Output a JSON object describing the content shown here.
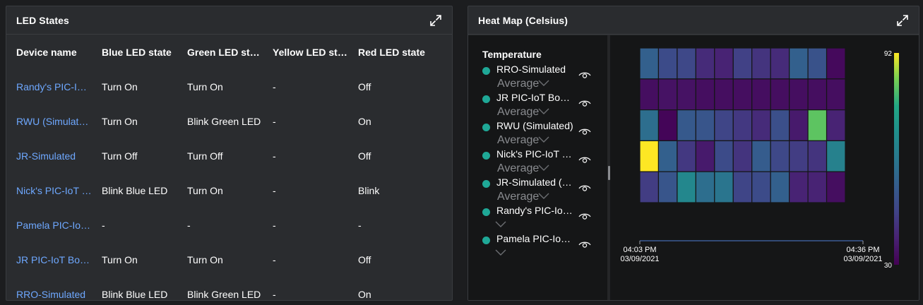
{
  "led_panel": {
    "title": "LED States",
    "columns": [
      "Device name",
      "Blue LED state",
      "Green LED state",
      "Yellow LED state",
      "Red LED state"
    ],
    "rows": [
      [
        "Randy's PIC-IoT Board",
        "Turn On",
        "Turn On",
        "-",
        "Off"
      ],
      [
        "RWU (Simulated)",
        "Turn On",
        "Blink Green LED",
        "-",
        "On"
      ],
      [
        "JR-Simulated",
        "Turn Off",
        "Turn Off",
        "-",
        "Off"
      ],
      [
        "Nick's PIC-IoT Board",
        "Blink Blue LED",
        "Turn On",
        "-",
        "Blink"
      ],
      [
        "Pamela PIC-IoT Board",
        "-",
        "-",
        "-",
        "-"
      ],
      [
        "JR PIC-IoT Board",
        "Turn On",
        "Turn On",
        "-",
        "Off"
      ],
      [
        "RRO-Simulated",
        "Blink Blue LED",
        "Blink Green LED",
        "-",
        "On"
      ]
    ]
  },
  "heat_panel": {
    "title": "Heat Map (Celsius)",
    "legend_title": "Temperature",
    "legend_items": [
      {
        "name": "RRO-Simulated",
        "stat": "Average"
      },
      {
        "name": "JR PIC-IoT Board",
        "stat": "Average"
      },
      {
        "name": "RWU (Simulated)",
        "stat": "Average"
      },
      {
        "name": "Nick's PIC-IoT Board",
        "stat": "Average"
      },
      {
        "name": "JR-Simulated (Simulated)",
        "stat": "Average"
      },
      {
        "name": "Randy's PIC-IoT Board",
        "stat": ""
      },
      {
        "name": "Pamela PIC-IoT Board",
        "stat": ""
      }
    ],
    "x_start": {
      "time": "04:03 PM",
      "date": "03/09/2021"
    },
    "x_end": {
      "time": "04:36 PM",
      "date": "03/09/2021"
    }
  },
  "colors": {
    "accent_link": "#6ea8ff",
    "series_dot": "#1fa897",
    "panel_bg": "#2a2c2f",
    "chart_bg": "#151617"
  },
  "chart_data": {
    "type": "heatmap",
    "title": "Heat Map (Celsius)",
    "colorbar_range": [
      30,
      92
    ],
    "colorbar_labels": [
      "92",
      "30"
    ],
    "x_labels": [
      [
        "04:03 PM",
        "03/09/2021"
      ],
      [
        "04:36 PM",
        "03/09/2021"
      ]
    ],
    "values": [
      [
        54,
        48,
        47,
        40,
        38,
        45,
        42,
        40,
        54,
        50,
        32
      ],
      [
        33,
        34,
        34,
        33,
        33,
        33,
        33,
        33,
        33,
        33,
        33
      ],
      [
        58,
        31,
        52,
        51,
        46,
        43,
        40,
        49,
        36,
        82,
        38
      ],
      [
        92,
        54,
        43,
        36,
        48,
        42,
        53,
        47,
        44,
        42,
        64
      ],
      [
        44,
        51,
        66,
        58,
        60,
        46,
        48,
        54,
        38,
        38,
        33
      ]
    ]
  }
}
